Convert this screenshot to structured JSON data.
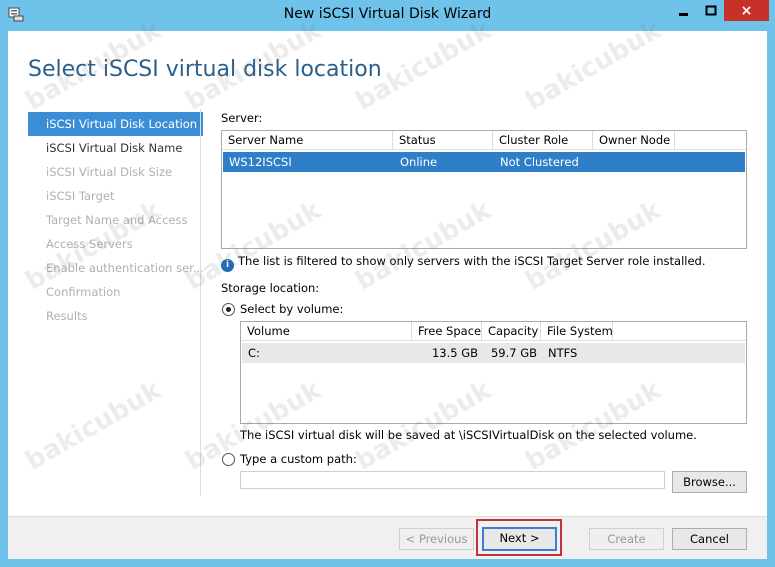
{
  "window": {
    "title": "New iSCSI Virtual Disk Wizard",
    "close_glyph": "×"
  },
  "header": {
    "title": "Select iSCSI virtual disk location"
  },
  "nav": {
    "items": [
      {
        "label": "iSCSI Virtual Disk Location",
        "state": "active"
      },
      {
        "label": "iSCSI Virtual Disk Name",
        "state": "normal"
      },
      {
        "label": "iSCSI Virtual Disk Size",
        "state": "disabled"
      },
      {
        "label": "iSCSI Target",
        "state": "disabled"
      },
      {
        "label": "Target Name and Access",
        "state": "disabled"
      },
      {
        "label": "Access Servers",
        "state": "disabled"
      },
      {
        "label": "Enable authentication ser...",
        "state": "disabled"
      },
      {
        "label": "Confirmation",
        "state": "disabled"
      },
      {
        "label": "Results",
        "state": "disabled"
      }
    ]
  },
  "server": {
    "label": "Server:",
    "columns": [
      "Server Name",
      "Status",
      "Cluster Role",
      "Owner Node"
    ],
    "rows": [
      {
        "server_name": "WS12ISCSI",
        "status": "Online",
        "cluster_role": "Not Clustered",
        "owner_node": ""
      }
    ],
    "info": "The list is filtered to show only servers with the iSCSI Target Server role installed."
  },
  "storage": {
    "label": "Storage location:",
    "select_by_volume_label": "Select by volume:",
    "volume_columns": [
      "Volume",
      "Free Space",
      "Capacity",
      "File System"
    ],
    "volumes": [
      {
        "volume": "C:",
        "free_space": "13.5 GB",
        "capacity": "59.7 GB",
        "file_system": "NTFS"
      }
    ],
    "save_note": "The iSCSI virtual disk will be saved at \\iSCSIVirtualDisk on the selected volume.",
    "custom_path_label": "Type a custom path:",
    "custom_path_value": "",
    "browse_label": "Browse..."
  },
  "footer": {
    "previous_label": "< Previous",
    "next_label": "Next >",
    "create_label": "Create",
    "cancel_label": "Cancel"
  },
  "watermark": "bakicubuk",
  "colors": {
    "accent": "#3b8ed5",
    "title_text": "#2b5f8b",
    "frame": "#6fc3ea",
    "close": "#c7312a",
    "highlight": "#c0333a"
  }
}
